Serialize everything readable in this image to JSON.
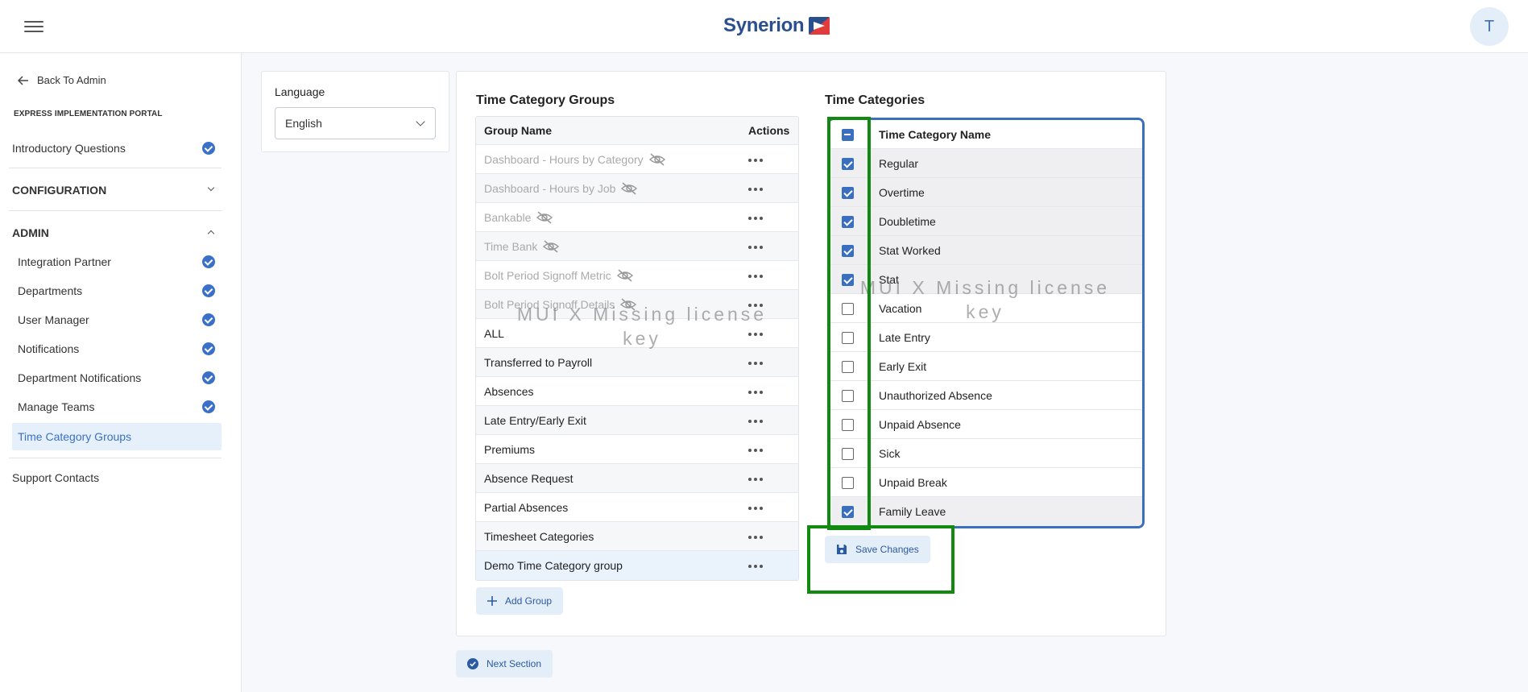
{
  "header": {
    "brand": "Synerion",
    "avatar_initial": "T"
  },
  "sidebar": {
    "back_label": "Back To Admin",
    "portal_title": "EXPRESS IMPLEMENTATION PORTAL",
    "intro": "Introductory Questions",
    "configuration": "CONFIGURATION",
    "admin": "ADMIN",
    "admin_items": [
      "Integration Partner",
      "Departments",
      "User Manager",
      "Notifications",
      "Department Notifications",
      "Manage Teams",
      "Time Category Groups"
    ],
    "support": "Support Contacts"
  },
  "language": {
    "label": "Language",
    "value": "English"
  },
  "groups": {
    "title": "Time Category Groups",
    "col_name": "Group Name",
    "col_actions": "Actions",
    "rows": [
      "Dashboard - Hours by Category",
      "Dashboard - Hours by Job",
      "Bankable",
      "Time Bank",
      "Bolt Period Signoff Metric",
      "Bolt Period Signoff Details",
      "ALL",
      "Transferred to Payroll",
      "Absences",
      "Late Entry/Early Exit",
      "Premiums",
      "Absence Request",
      "Partial Absences",
      "Timesheet Categories",
      "Demo Time Category group"
    ],
    "add_label": "Add Group"
  },
  "categories": {
    "title": "Time Categories",
    "col_name": "Time Category Name",
    "rows": [
      "Regular",
      "Overtime",
      "Doubletime",
      "Stat Worked",
      "Stat",
      "Vacation",
      "Late Entry",
      "Early Exit",
      "Unauthorized Absence",
      "Unpaid Absence",
      "Sick",
      "Unpaid Break",
      "Family Leave"
    ],
    "save_label": "Save Changes"
  },
  "watermark": {
    "line1": "MUI X Missing license",
    "line2": "key"
  },
  "footer": {
    "next_label": "Next Section"
  }
}
